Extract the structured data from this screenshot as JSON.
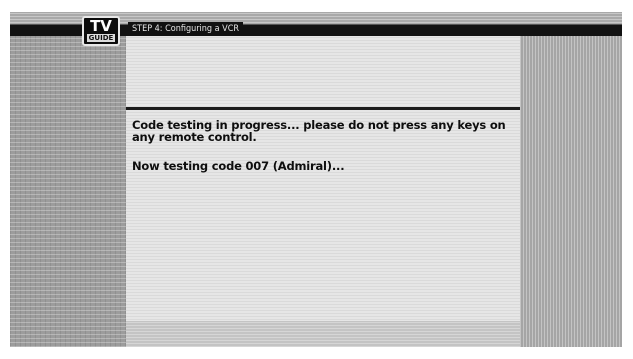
{
  "header": {
    "logo": {
      "line1": "TV",
      "line2": "GUIDE"
    },
    "step_title": "STEP 4: Configuring a VCR"
  },
  "main": {
    "message_progress": "Code testing in progress... please do not press any keys on any remote control.",
    "message_status": "Now testing code 007 (Admiral)..."
  },
  "colors": {
    "panel_gray": "#a9a9a9",
    "content_bg": "#e6e6e6",
    "header_black": "#111111"
  }
}
